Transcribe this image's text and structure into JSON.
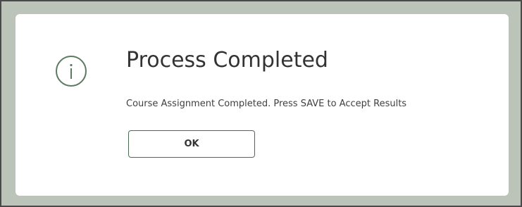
{
  "dialog": {
    "icon": "info-icon",
    "title": "Process Completed",
    "message": "Course Assignment Completed. Press SAVE to Accept Results",
    "ok_label": "OK"
  },
  "colors": {
    "backdrop": "#bcc3b8",
    "accent": "#5b7a5f"
  }
}
